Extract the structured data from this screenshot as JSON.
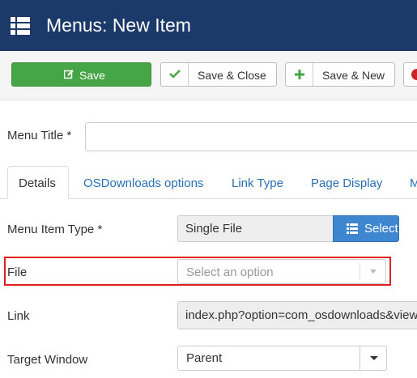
{
  "header": {
    "title": "Menus: New Item",
    "icon": "list-icon",
    "bg_color": "#1b3a69"
  },
  "toolbar": {
    "save_label": "Save",
    "save_close_label": "Save & Close",
    "save_new_label": "Save & New",
    "save_color": "#46a546"
  },
  "form": {
    "menu_title_label": "Menu Title *",
    "menu_title_value": "",
    "tabs": [
      "Details",
      "OSDownloads options",
      "Link Type",
      "Page Display",
      "M"
    ],
    "active_tab": "Details",
    "menu_item_type_label": "Menu Item Type *",
    "menu_item_type_value": "Single File",
    "select_button_label": "Select",
    "file_label": "File",
    "file_placeholder": "Select an option",
    "link_label": "Link",
    "link_value": "index.php?option=com_osdownloads&view=item",
    "target_window_label": "Target Window",
    "target_window_value": "Parent"
  }
}
